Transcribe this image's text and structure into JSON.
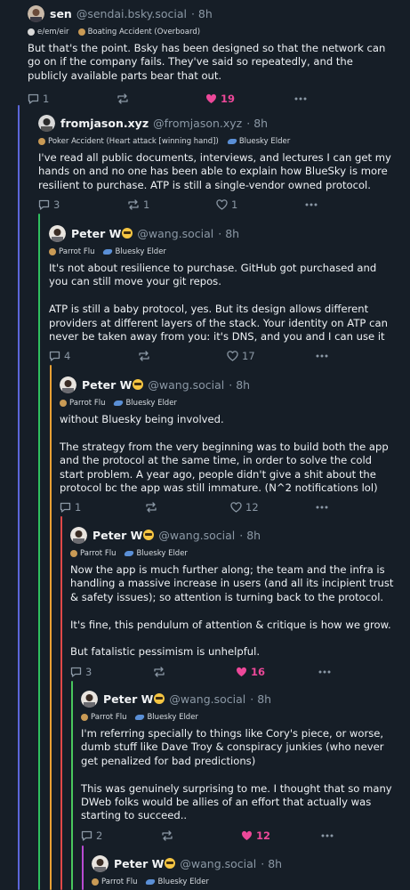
{
  "colors": {
    "background": "#161e27",
    "text": "#f1f3f5",
    "muted": "#8b98a5",
    "like": "#ec4899",
    "thread_lines": [
      "#5b66d9",
      "#2fbf5f",
      "#e8a035",
      "#e04848",
      "#49c75e",
      "#b94bd3"
    ]
  },
  "posts": [
    {
      "author": {
        "name": "sen",
        "handle": "@sendai.bsky.social",
        "avatar": "round-avatar-face"
      },
      "time": "· 8h",
      "badges": [
        {
          "label": "e/em/eir",
          "icon": "dot-icon"
        },
        {
          "label": "Boating Accident (Overboard)",
          "icon": "dot-icon"
        }
      ],
      "text": "But that's the point. Bsky has been designed so that the network can go on if the company fails. They've said so repeatedly, and the publicly available parts bear that out.",
      "replies": "1",
      "reposts": "",
      "likes": "19",
      "liked": true
    },
    {
      "author": {
        "name": "fromjason.xyz",
        "handle": "@fromjason.xyz",
        "avatar": "round-avatar-face"
      },
      "time": "· 8h",
      "badges": [
        {
          "label": "Poker Accident (Heart attack [winning hand])",
          "icon": "dot-icon"
        },
        {
          "label": "Bluesky Elder",
          "icon": "butterfly-icon"
        }
      ],
      "text": "I've read all public documents, interviews, and lectures I can get my hands on and no one has been able to explain how BlueSky is more resilient to purchase. ATP is still a single-vendor owned protocol.",
      "replies": "3",
      "reposts": "1",
      "likes": "1",
      "liked": false
    },
    {
      "author": {
        "name": "Peter W",
        "handle": "@wang.social",
        "avatar": "round-avatar-face"
      },
      "time": "· 8h",
      "badges": [
        {
          "label": "Parrot Flu",
          "icon": "dot-icon"
        },
        {
          "label": "Bluesky Elder",
          "icon": "butterfly-icon"
        }
      ],
      "text": "It's not about resilience to purchase. GitHub got purchased and you can still move your git repos.\n\nATP is still a baby protocol, yes. But its design allows different providers at different layers of the stack. Your identity on ATP can never be taken away from you: it's DNS, and you and I can use it",
      "replies": "4",
      "reposts": "",
      "likes": "17",
      "liked": false
    },
    {
      "author": {
        "name": "Peter W",
        "handle": "@wang.social",
        "avatar": "round-avatar-face"
      },
      "time": "· 8h",
      "badges": [
        {
          "label": "Parrot Flu",
          "icon": "dot-icon"
        },
        {
          "label": "Bluesky Elder",
          "icon": "butterfly-icon"
        }
      ],
      "text": "without Bluesky being involved.\n\nThe strategy from the very beginning was to build both the app and the protocol at the same time, in order to solve the cold start problem. A year ago, people didn't give a shit about the protocol bc the app was still immature. (N^2 notifications lol)",
      "replies": "1",
      "reposts": "",
      "likes": "12",
      "liked": false
    },
    {
      "author": {
        "name": "Peter W",
        "handle": "@wang.social",
        "avatar": "round-avatar-face"
      },
      "time": "· 8h",
      "badges": [
        {
          "label": "Parrot Flu",
          "icon": "dot-icon"
        },
        {
          "label": "Bluesky Elder",
          "icon": "butterfly-icon"
        }
      ],
      "text": "Now the app is much further along; the team and the infra is handling a massive increase in users (and all its incipient trust & safety issues); so attention is turning back to the protocol.\n\nIt's fine, this pendulum of attention & critique is how we grow.\n\nBut fatalistic pessimism is unhelpful.",
      "replies": "3",
      "reposts": "",
      "likes": "16",
      "liked": true
    },
    {
      "author": {
        "name": "Peter W",
        "handle": "@wang.social",
        "avatar": "round-avatar-face"
      },
      "time": "· 8h",
      "badges": [
        {
          "label": "Parrot Flu",
          "icon": "dot-icon"
        },
        {
          "label": "Bluesky Elder",
          "icon": "butterfly-icon"
        }
      ],
      "text": "I'm referring specially to things like Cory's piece, or worse, dumb stuff like Dave Troy & conspiracy junkies (who never get penalized for bad predictions)\n\nThis was genuinely surprising to me. I thought that so many DWeb folks would be allies of an effort that actually was starting to succeed..",
      "replies": "2",
      "reposts": "",
      "likes": "12",
      "liked": true
    },
    {
      "author": {
        "name": "Peter W",
        "handle": "@wang.social",
        "avatar": "round-avatar-face"
      },
      "time": "· 8h",
      "badges": [
        {
          "label": "Parrot Flu",
          "icon": "dot-icon"
        },
        {
          "label": "Bluesky Elder",
          "icon": "butterfly-icon"
        }
      ],
      "text": "",
      "replies": "",
      "reposts": "",
      "likes": "",
      "liked": false
    }
  ]
}
